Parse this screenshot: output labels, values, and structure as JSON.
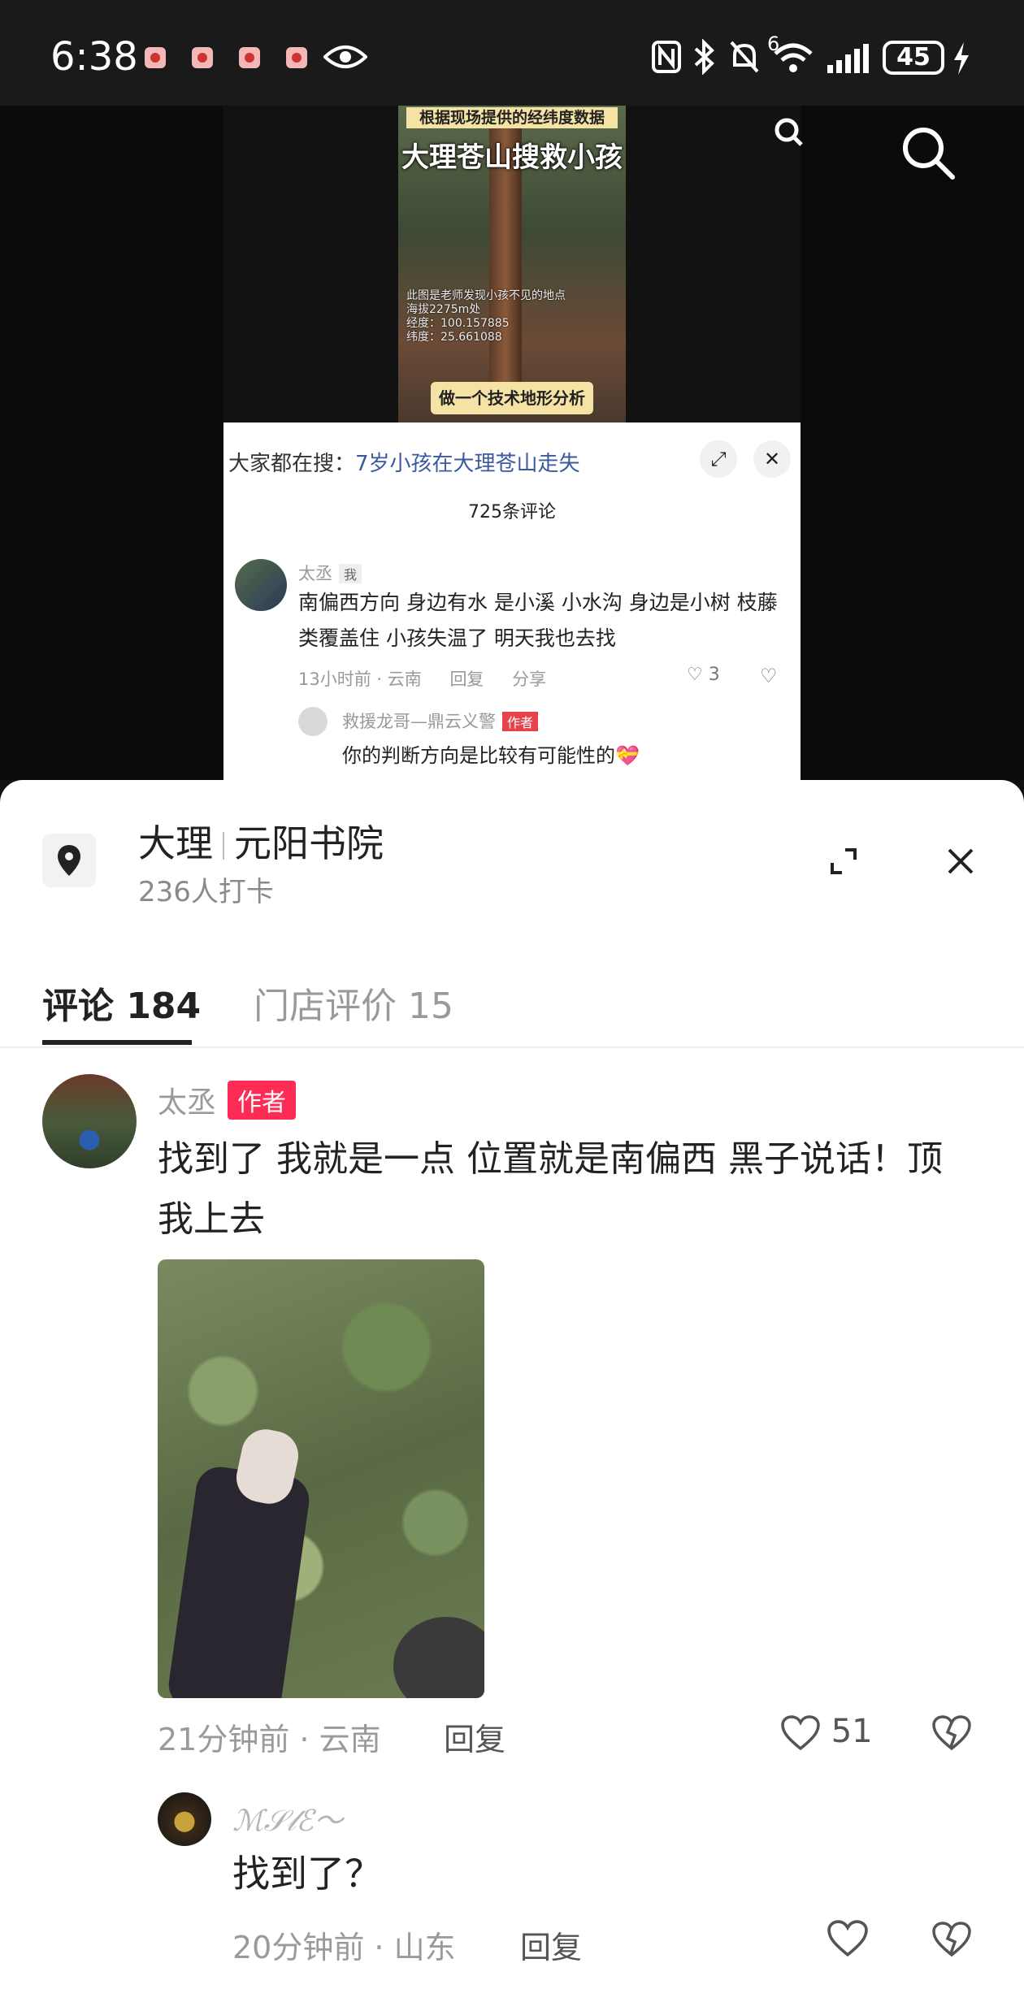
{
  "status_bar": {
    "time": "6:38",
    "signal_label": "6",
    "battery": "45"
  },
  "video": {
    "caption_top": "根据现场提供的经纬度数据",
    "caption_main": "大理苍山搜救小孩",
    "caption_coords": [
      "此图是老师发现小孩不见的地点",
      "海拔2275m处",
      "经度：100.157885",
      "纬度：25.661088"
    ],
    "caption_bottom": "做一个技术地形分析"
  },
  "embedded_comments": {
    "search_prefix": "大家都在搜：",
    "search_query": "7岁小孩在大理苍山走失",
    "count": "725条评论",
    "comment": {
      "user": "太丞",
      "me_badge": "我",
      "text": "南偏西方向 身边有水 是小溪 小水沟 身边是小树 枝藤类覆盖住 小孩失温了 明天我也去找",
      "time_location": "13小时前 · 云南",
      "reply": "回复",
      "share": "分享",
      "likes": "3"
    },
    "reply": {
      "user": "救援龙哥—鼎云义警",
      "author_badge": "作者",
      "text": "你的判断方向是比较有可能性的💝"
    }
  },
  "sheet": {
    "title_city": "大理",
    "title_place": "元阳书院",
    "subtitle": "236人打卡",
    "tabs": [
      {
        "label": "评论 184",
        "active": true
      },
      {
        "label": "门店评价 15",
        "active": false
      }
    ],
    "comment": {
      "user": "太丞",
      "author_badge": "作者",
      "text": "找到了 我就是一点 位置就是南偏西 黑子说话！顶我上去",
      "time_location": "21分钟前 · 云南",
      "reply": "回复",
      "likes": "51"
    },
    "reply": {
      "user": "ℳ𝒮𝓁ℰ〜",
      "text": "找到了？",
      "time_location": "20分钟前 · 山东",
      "reply": "回复"
    }
  },
  "colors": {
    "accent": "#fe2c55",
    "text_primary": "#222222",
    "text_secondary": "#9a9a9a"
  }
}
